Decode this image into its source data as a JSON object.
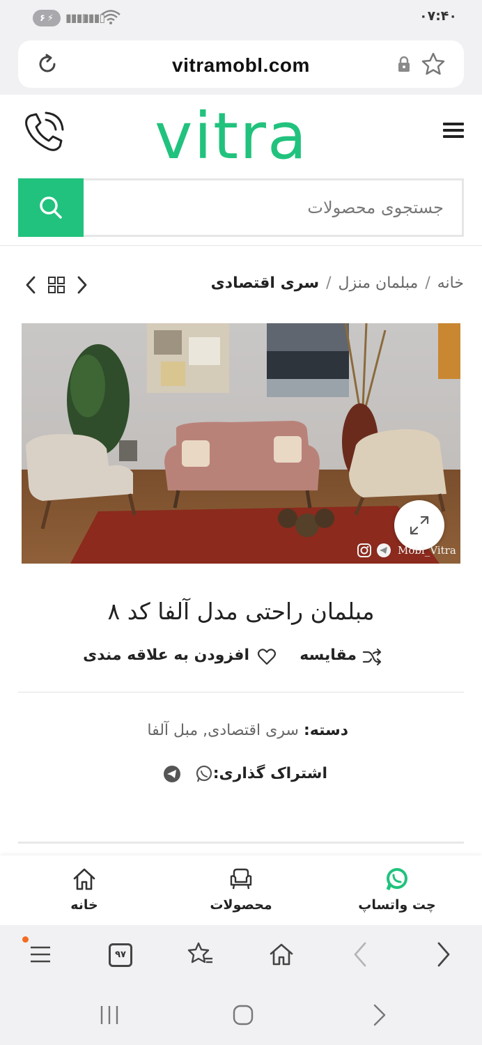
{
  "status_bar": {
    "battery_level": "۶",
    "time": "۰۷:۴۰"
  },
  "browser": {
    "url": "vitramobl.com",
    "tabs_count": "۹۷"
  },
  "site": {
    "logo_text": "vitra",
    "brand_color": "#21c27d",
    "search_placeholder": "جستجوی محصولات"
  },
  "breadcrumb": {
    "items": [
      "خانه",
      "مبلمان منزل",
      "سری اقتصادی"
    ],
    "separator": "/"
  },
  "product": {
    "image_watermark": "Mobl_Vitra",
    "title": "مبلمان راحتی مدل آلفا کد ۸",
    "compare_label": "مقایسه",
    "wishlist_label": "افزودن به علاقه مندی",
    "category_label": "دسته:",
    "category_values": "سری اقتصادی, مبل آلفا",
    "share_label": "اشتراک گذاری:"
  },
  "bottom_nav": {
    "whatsapp_label": "چت واتساپ",
    "products_label": "محصولات",
    "home_label": "خانه"
  }
}
